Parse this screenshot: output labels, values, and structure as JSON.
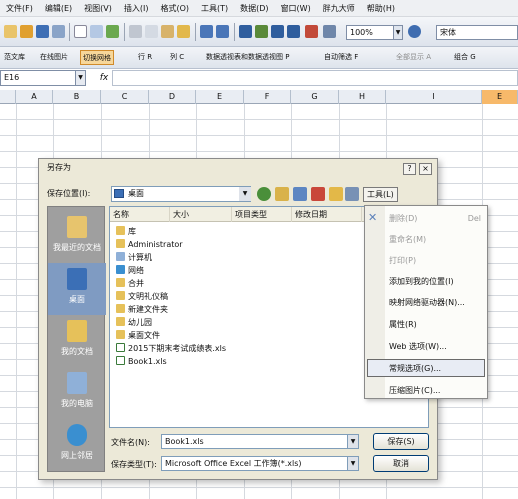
{
  "menubar": {
    "items": [
      "文件(F)",
      "编辑(E)",
      "视图(V)",
      "插入(I)",
      "格式(O)",
      "工具(T)",
      "数据(D)",
      "窗口(W)",
      "胖九大师",
      "帮助(H)"
    ]
  },
  "toolbar1": {
    "zoom": "100%",
    "font": "宋体"
  },
  "toolbar2": {
    "items": [
      "范文库",
      "在线图片",
      "切换网格",
      "行 R",
      "列 C",
      "数据透视表和数据透视图 P",
      "自动筛选 F",
      "全部显示 A",
      "组合 G"
    ]
  },
  "formula_bar": {
    "name_box": "E16",
    "fx": "fx"
  },
  "sheet": {
    "columns": [
      "A",
      "B",
      "C",
      "D",
      "E",
      "F",
      "G",
      "H",
      "I",
      "E"
    ]
  },
  "dialog": {
    "title": "另存为",
    "save_in_label": "保存位置(I):",
    "save_in_value": "桌面",
    "tools_label": "工具(L)",
    "places": [
      "我最近的文档",
      "桌面",
      "我的文档",
      "我的电脑",
      "网上邻居"
    ],
    "columns": [
      "名称",
      "大小",
      "项目类型",
      "修改日期"
    ],
    "files": [
      "库",
      "Administrator",
      "计算机",
      "网络",
      "合并",
      "文明礼仪稿",
      "新建文件夹",
      "幼儿园",
      "桌面文件",
      "2015下期末考试成绩表.xls",
      "Book1.xls"
    ],
    "filename_label": "文件名(N):",
    "filename_value": "Book1.xls",
    "filetype_label": "保存类型(T):",
    "filetype_value": "Microsoft Office Excel 工作簿(*.xls)",
    "save_button": "保存(S)",
    "cancel_button": "取消"
  },
  "tools_menu": {
    "items": [
      {
        "label": "删除(D)",
        "shortcut": "Del",
        "enabled": false
      },
      {
        "label": "重命名(M)",
        "shortcut": "",
        "enabled": false
      },
      {
        "label": "打印(P)",
        "shortcut": "",
        "enabled": false
      },
      {
        "label": "添加到我的位置(I)",
        "shortcut": "",
        "enabled": true
      },
      {
        "label": "映射网络驱动器(N)...",
        "shortcut": "",
        "enabled": true
      },
      {
        "label": "属性(R)",
        "shortcut": "",
        "enabled": true
      },
      {
        "label": "Web 选项(W)...",
        "shortcut": "",
        "enabled": true
      },
      {
        "label": "常规选项(G)...",
        "shortcut": "",
        "enabled": true
      },
      {
        "label": "压缩图片(C)...",
        "shortcut": "",
        "enabled": true
      }
    ]
  },
  "colors": {
    "selected_column": "#f7b96a",
    "dialog_bg": "#ece9d8",
    "places_bg": "#9f9f9f"
  }
}
